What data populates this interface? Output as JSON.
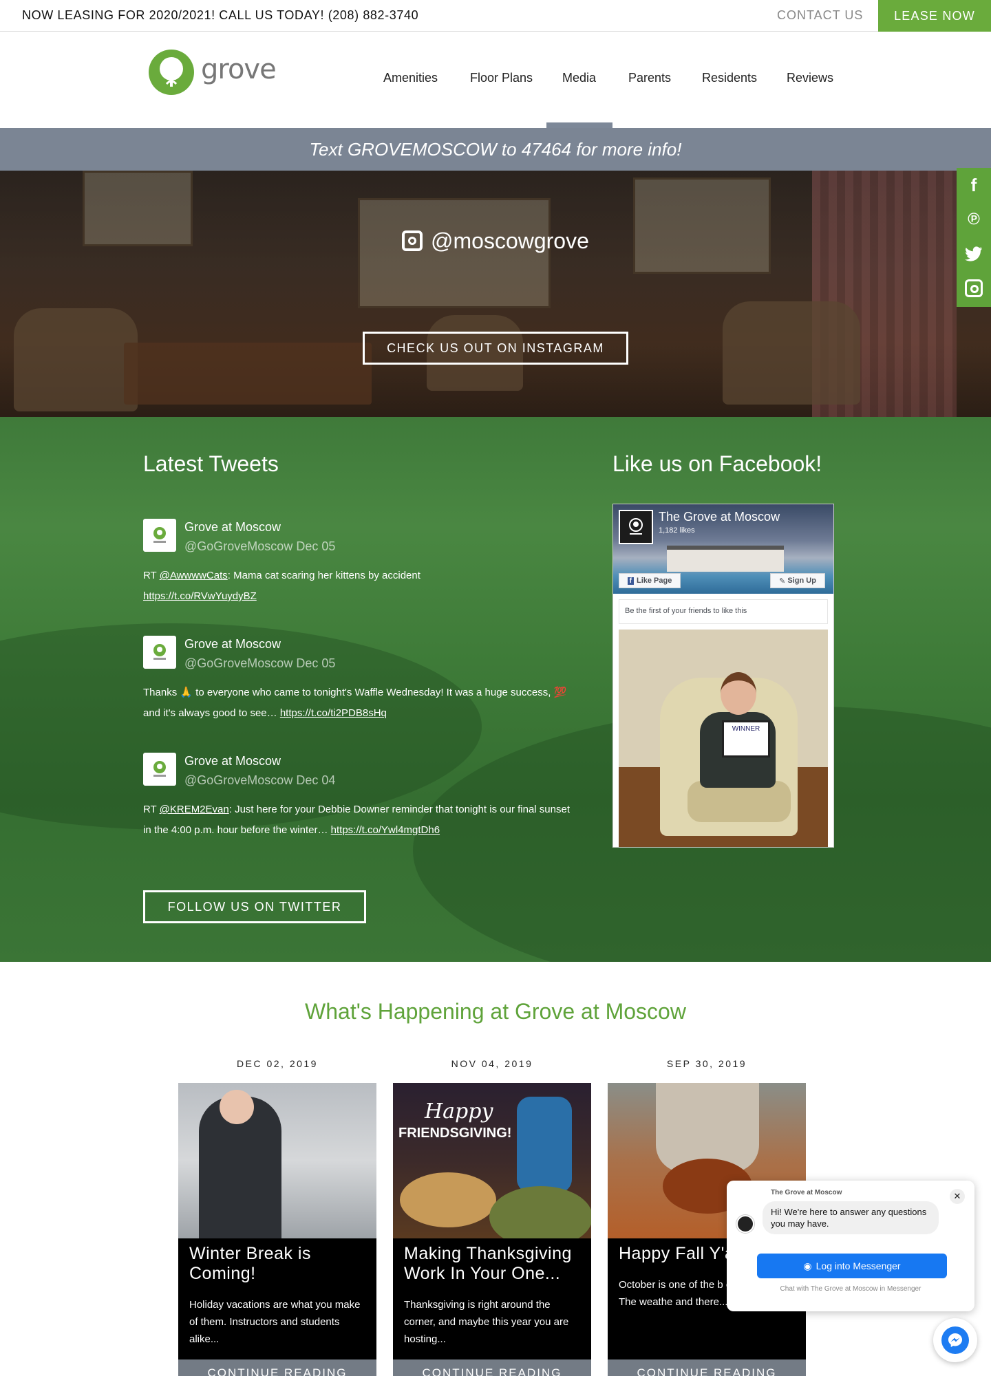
{
  "topbar": {
    "leasing_text": "NOW LEASING FOR 2020/2021! CALL US TODAY! (208) 882-3740",
    "contact_label": "CONTACT US",
    "lease_label": "LEASE NOW"
  },
  "header": {
    "logo_text": "grove",
    "nav": [
      "Amenities",
      "Floor Plans",
      "Media",
      "Parents",
      "Residents",
      "Reviews"
    ],
    "active_nav": "Media"
  },
  "info_bar": {
    "text": "Text GROVEMOSCOW to 47464 for more info!"
  },
  "instagram": {
    "handle": "@moscowgrove",
    "button_label": "CHECK US OUT ON INSTAGRAM"
  },
  "social": {
    "icons": [
      "facebook-icon",
      "pinterest-icon",
      "twitter-icon",
      "instagram-icon"
    ]
  },
  "tweets": {
    "heading": "Latest Tweets",
    "items": [
      {
        "name": "Grove at Moscow",
        "handle": "@GoGroveMoscow",
        "date": "Dec 05",
        "prefix": "RT ",
        "mention": "@AwwwwCats",
        "text": ": Mama cat scaring her kittens by accident",
        "link": "https://t.co/RVwYuydyBZ"
      },
      {
        "name": "Grove at Moscow",
        "handle": "@GoGroveMoscow",
        "date": "Dec 05",
        "prefix": "Thanks 🙏 to everyone who came to tonight's Waffle Wednesday! It was a huge success, 💯 and it's always good to see…",
        "mention": "",
        "text": "",
        "link": "https://t.co/ti2PDB8sHq"
      },
      {
        "name": "Grove at Moscow",
        "handle": "@GoGroveMoscow",
        "date": "Dec 04",
        "prefix": "RT ",
        "mention": "@KREM2Evan",
        "text": ": Just here for your Debbie Downer reminder that tonight is our final sunset in the 4:00 p.m. hour before the winter…",
        "link": "https://t.co/Ywl4mgtDh6"
      }
    ],
    "follow_label": "FOLLOW US ON TWITTER"
  },
  "facebook": {
    "heading": "Like us on Facebook!",
    "page_name": "The Grove at Moscow",
    "likes": "1,182 likes",
    "like_label": "Like Page",
    "signup_label": "Sign Up",
    "first_friends": "Be the first of your friends to like this",
    "sign_text": "WINNER"
  },
  "happening": {
    "title": "What's Happening at Grove at Moscow",
    "posts": [
      {
        "date": "DEC 02, 2019",
        "title": "Winter Break is Coming!",
        "excerpt": "Holiday vacations are what you make of them. Instructors and students alike...",
        "more": "CONTINUE READING"
      },
      {
        "date": "NOV 04, 2019",
        "title": "Making Thanksgiving Work In Your One...",
        "excerpt": "Thanksgiving is right around the corner, and maybe this year you are hosting...",
        "more": "CONTINUE READING",
        "image_text_1": "Happy",
        "image_text_2": "FRIENDSGIVING!"
      },
      {
        "date": "SEP 30, 2019",
        "title": "Happy Fall Y'a",
        "excerpt": "October is one of the b of the year. The weathe and there...",
        "more": "CONTINUE READING"
      }
    ]
  },
  "chat": {
    "page_name": "The Grove at Moscow",
    "message": "Hi! We're here to answer any questions you may have.",
    "button_label": "Log into Messenger",
    "footer": "Chat with The Grove at Moscow in Messenger",
    "close": "✕"
  },
  "colors": {
    "brand_green": "#6aab3c",
    "gray_bar": "#7b8594",
    "messenger_blue": "#1778f2"
  }
}
